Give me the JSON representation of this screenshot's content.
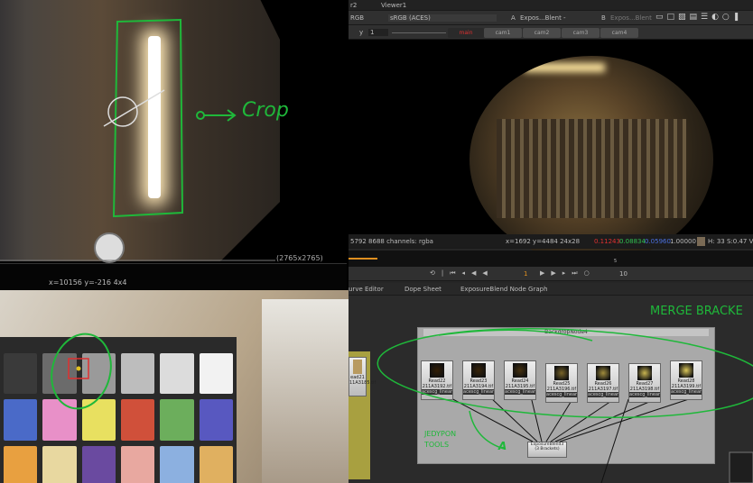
{
  "left_viewer": {
    "resolution": "(2765x2765)",
    "annotation": "Crop",
    "coords": "x=10156 y=-216 4x4"
  },
  "viewer": {
    "tabs": [
      "r2",
      "Viewer1"
    ],
    "colorspace_left": "RGB",
    "colorspace": "sRGB (ACES)",
    "input_a_label": "A",
    "input_a": "Expos...Blent",
    "input_a_op": "-",
    "input_b_label": "B",
    "input_b": "Expos...Blent",
    "y_label": "y",
    "y_value": "1",
    "views": [
      "main",
      "cam1",
      "cam2",
      "cam3",
      "cam4"
    ],
    "info": {
      "channels": "5792 8688 channels: rgba",
      "coords": "x=1692 y=4484 24x28",
      "r": "0.11243",
      "g": "0.08834",
      "b": "0.05960",
      "a": "1.00000",
      "hsv": "H: 33 S:0.47 V:"
    },
    "swatch": "#7a6a55"
  },
  "timeline": {
    "frame": "1",
    "step": "10",
    "marker": "5"
  },
  "panels": {
    "tabs": [
      "urve Editor",
      "Dope Sheet",
      "ExposureBlend Node Graph"
    ]
  },
  "node_graph": {
    "backdrop": "BackdropNode4",
    "annotation_merge": "MERGE BRACKE",
    "annotation_tools": "JEDYPON TOOLS",
    "annotation_letter": "A",
    "side_node": {
      "name": "ead21",
      "file": "11A3185.tif",
      "cs": "_linear"
    },
    "reads": [
      {
        "name": "Read22",
        "file": "211A3192.tif",
        "cs": "acescg_linear",
        "bright": 0.05
      },
      {
        "name": "Read23",
        "file": "211A3194.tif",
        "cs": "acescg_linear",
        "bright": 0.08
      },
      {
        "name": "Read24",
        "file": "211A3195.tif",
        "cs": "acescg_linear",
        "bright": 0.15
      },
      {
        "name": "Read25",
        "file": "211A3196.tif",
        "cs": "acescg_linear",
        "bright": 0.4
      },
      {
        "name": "Read26",
        "file": "211A3197.tif",
        "cs": "acescg_linear",
        "bright": 0.6
      },
      {
        "name": "Read27",
        "file": "211A3198.tif",
        "cs": "acescg_linear",
        "bright": 0.8
      },
      {
        "name": "Read28",
        "file": "211A3199.tif",
        "cs": "acescg_linear",
        "bright": 0.9
      }
    ],
    "blend_node": {
      "name": "ExposureBlend3",
      "sub": "(3 Brackets)"
    }
  }
}
